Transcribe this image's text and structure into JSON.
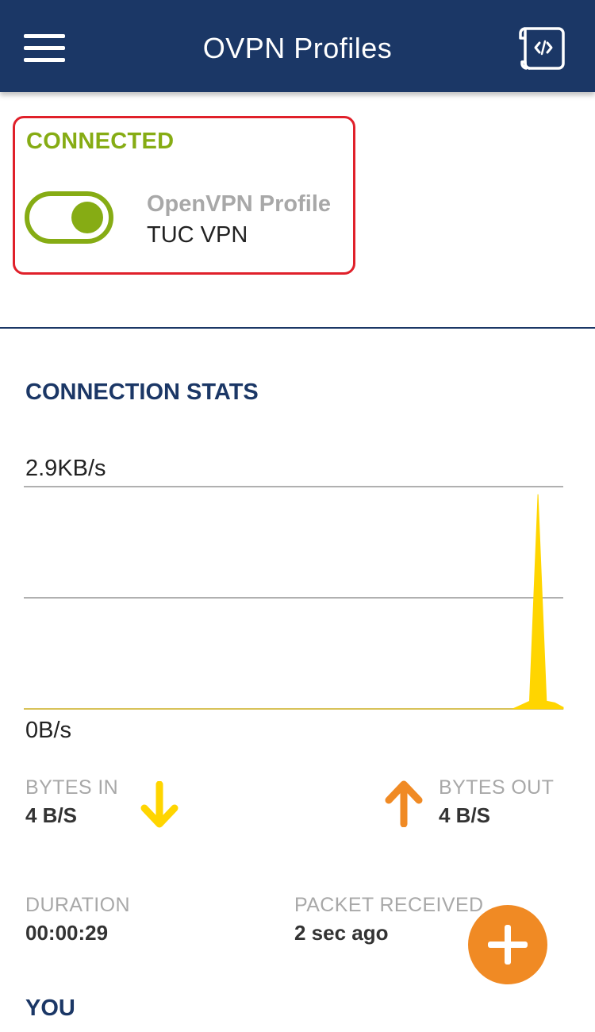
{
  "header": {
    "title": "OVPN Profiles",
    "menu_icon": "hamburger-menu-icon",
    "log_icon": "code-scroll-icon",
    "background": "#1b3766"
  },
  "profile": {
    "status": "CONNECTED",
    "toggle_state": "on",
    "type_label": "OpenVPN Profile",
    "name": "TUC VPN",
    "accent": "#86ac14",
    "highlight_border": "#e0202a"
  },
  "stats": {
    "title": "CONNECTION STATS",
    "chart_data": {
      "type": "area",
      "ymax_label": "2.9KB/s",
      "ymin_label": "0B/s",
      "grid": true,
      "series_color": "#ffd500",
      "values": [
        0,
        0,
        0,
        0,
        0,
        0,
        0,
        0,
        0,
        0,
        0,
        0,
        0,
        0,
        0,
        0,
        0,
        0,
        0,
        0,
        0,
        0,
        0,
        0,
        0,
        0,
        0,
        0,
        0,
        0,
        0,
        0,
        0,
        0,
        0,
        0,
        0,
        0,
        0,
        0,
        0,
        0,
        0,
        0,
        0,
        0,
        0,
        0,
        0,
        0,
        0,
        0,
        0,
        0,
        0,
        0,
        0,
        0,
        0,
        0.05,
        0.1,
        2.8,
        0.1,
        0.08,
        0.02
      ]
    },
    "bytes_in": {
      "label": "BYTES IN",
      "value": "4 B/S",
      "icon": "arrow-down-icon",
      "color": "#ffd500"
    },
    "bytes_out": {
      "label": "BYTES OUT",
      "value": "4 B/S",
      "icon": "arrow-up-icon",
      "color": "#f08a24"
    },
    "duration": {
      "label": "DURATION",
      "value": "00:00:29"
    },
    "packet_received": {
      "label": "PACKET RECEIVED",
      "value": "2 sec ago"
    }
  },
  "you_section": {
    "title": "YOU"
  },
  "fab": {
    "icon": "plus-icon",
    "color": "#f08a24"
  }
}
